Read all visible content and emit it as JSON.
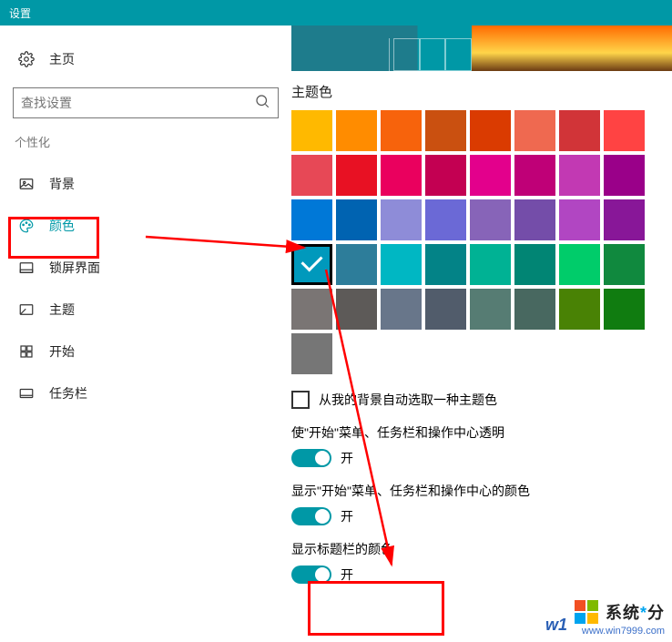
{
  "window_title": "设置",
  "sidebar": {
    "home_label": "主页",
    "search_placeholder": "查找设置",
    "section_label": "个性化",
    "items": [
      {
        "label": "背景"
      },
      {
        "label": "颜色"
      },
      {
        "label": "锁屏界面"
      },
      {
        "label": "主题"
      },
      {
        "label": "开始"
      },
      {
        "label": "任务栏"
      }
    ]
  },
  "main": {
    "accent_title": "主题色",
    "swatches": [
      "#ffb900",
      "#ff8c00",
      "#f7630c",
      "#ca5010",
      "#da3b01",
      "#ef6950",
      "#d13438",
      "#ff4343",
      "#e74856",
      "#e81123",
      "#ea005e",
      "#c30052",
      "#e3008c",
      "#bf0077",
      "#c239b3",
      "#9a0089",
      "#0078d7",
      "#0063b1",
      "#8e8cd8",
      "#6b69d6",
      "#8764b8",
      "#744da9",
      "#b146c2",
      "#881798",
      "#0099bc",
      "#2d7d9a",
      "#00b7c3",
      "#038387",
      "#00b294",
      "#018574",
      "#00cc6a",
      "#10893e",
      "#7a7574",
      "#5d5a58",
      "#68768a",
      "#515c6b",
      "#567c73",
      "#486860",
      "#498205",
      "#107c10",
      "#767676"
    ],
    "selected_index": 24,
    "auto_pick_label": "从我的背景自动选取一种主题色",
    "toggles": [
      {
        "label": "使\"开始\"菜单、任务栏和操作中心透明",
        "state": "开"
      },
      {
        "label": "显示\"开始\"菜单、任务栏和操作中心的颜色",
        "state": "开"
      },
      {
        "label": "显示标题栏的颜色",
        "state": "开"
      }
    ]
  },
  "watermark": {
    "brand_left": "系统",
    "brand_right": "分",
    "url": "www.win7999.com",
    "w10": "w1"
  }
}
